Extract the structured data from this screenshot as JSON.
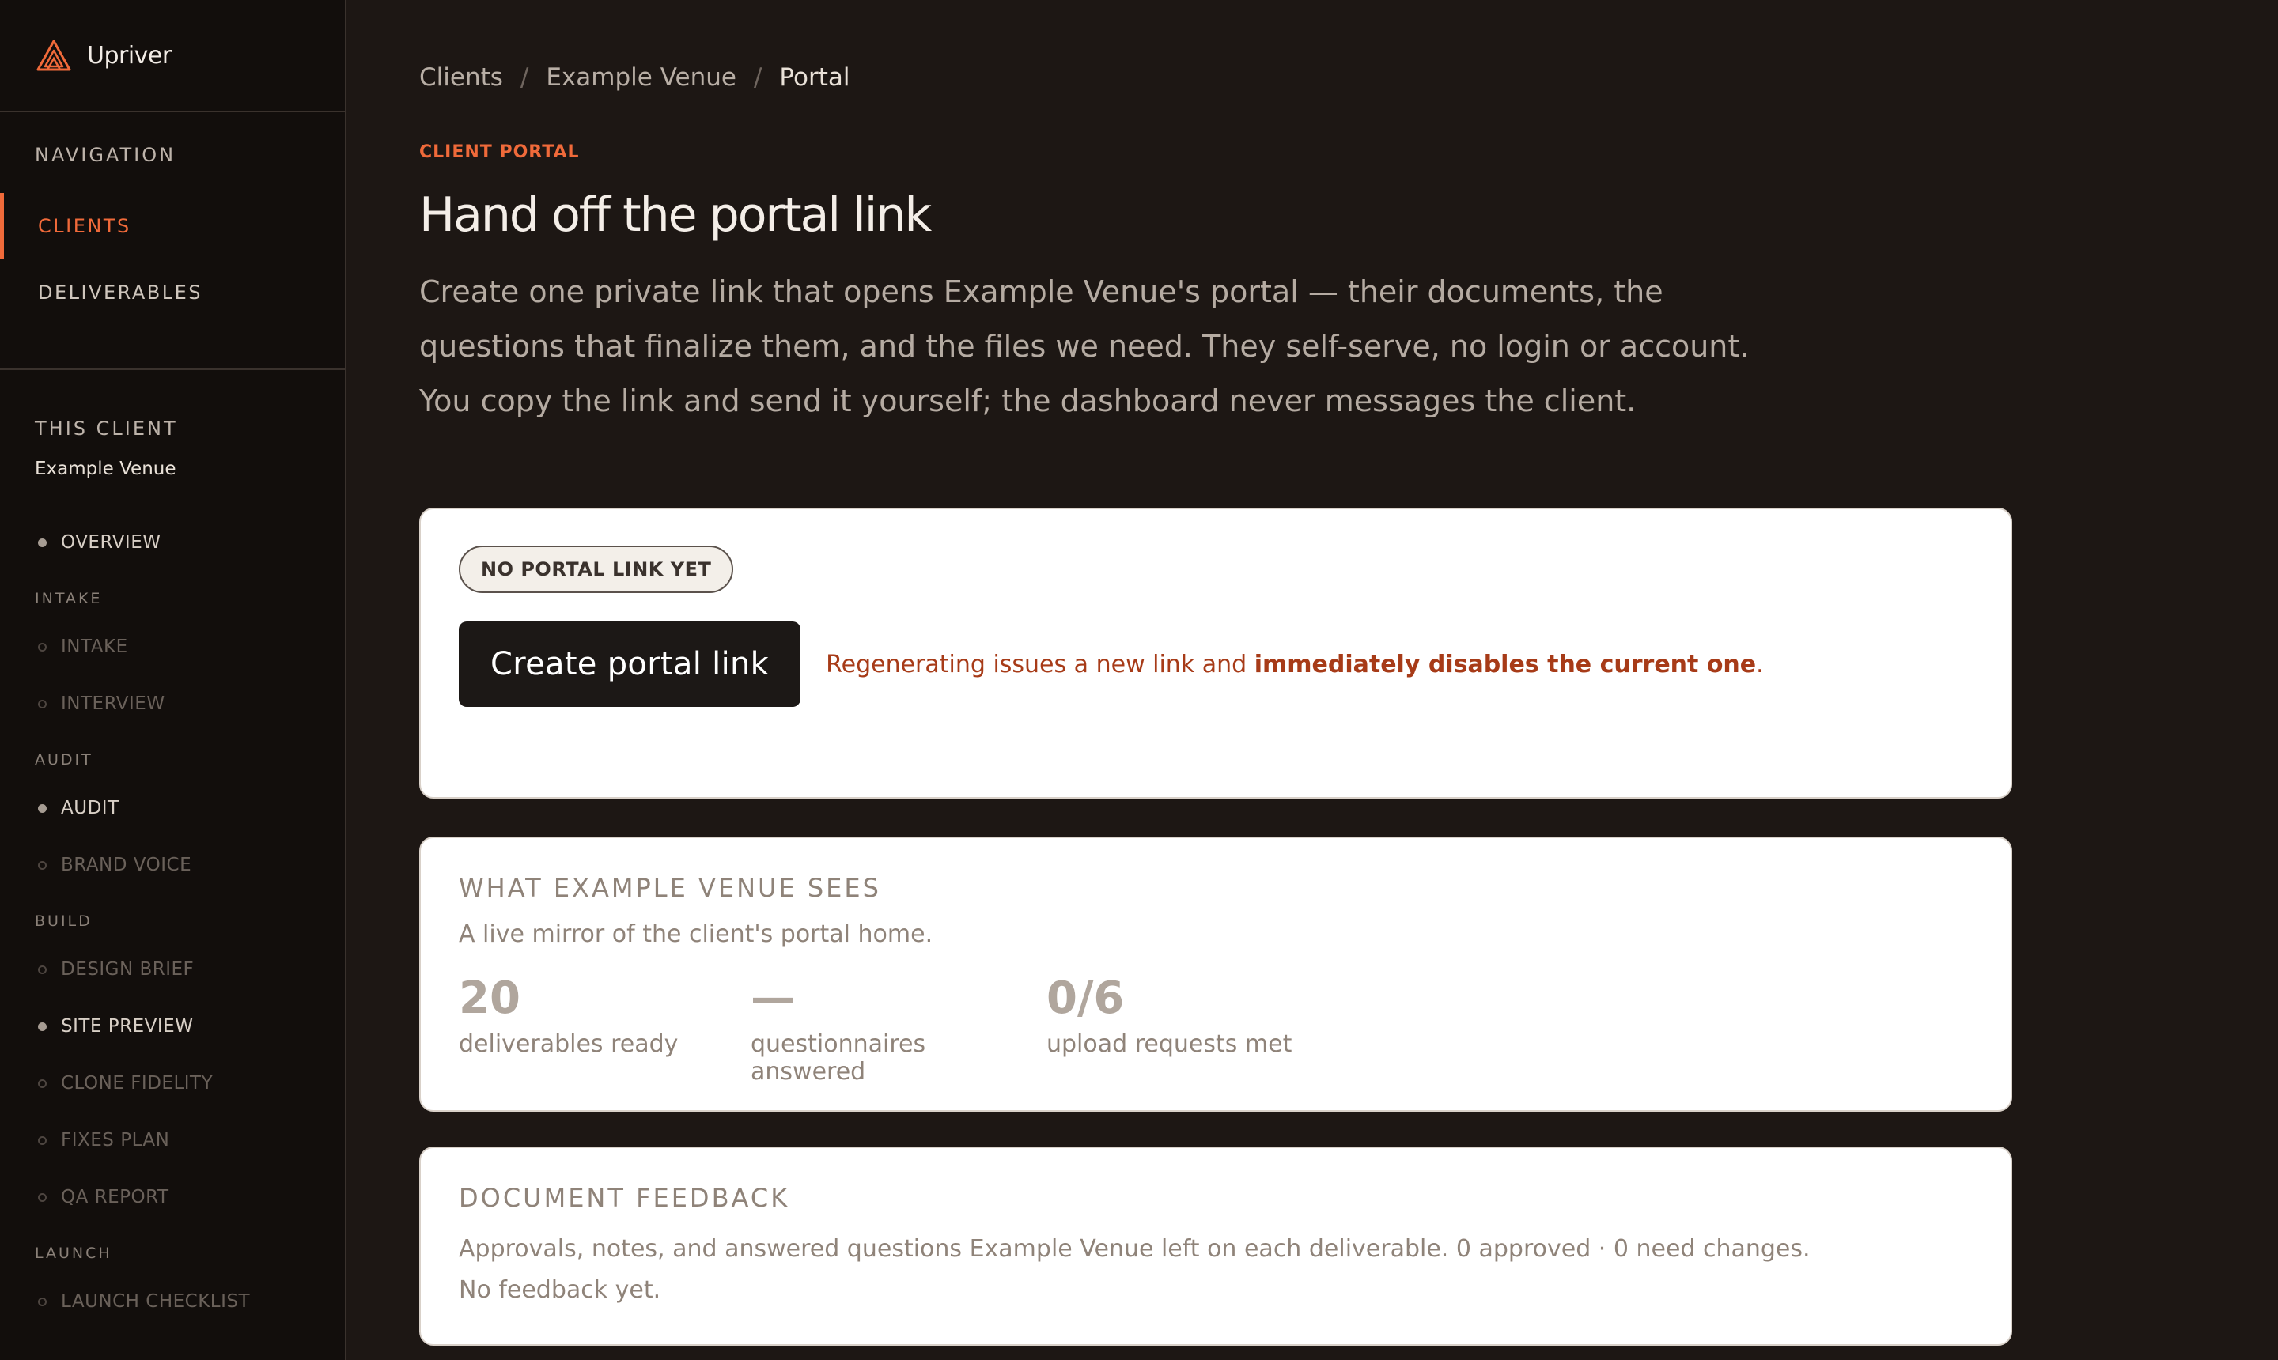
{
  "brand": {
    "name": "Upriver",
    "accent": "#f06a3a"
  },
  "sidebar": {
    "nav_title": "NAVIGATION",
    "nav_items": [
      {
        "label": "CLIENTS",
        "active": true
      },
      {
        "label": "DELIVERABLES",
        "active": false
      }
    ],
    "client_title": "THIS CLIENT",
    "client_name": "Example Venue",
    "overview": "OVERVIEW",
    "groups": [
      {
        "label": "INTAKE",
        "items": [
          {
            "label": "INTAKE",
            "done": false
          },
          {
            "label": "INTERVIEW",
            "done": false
          }
        ]
      },
      {
        "label": "AUDIT",
        "items": [
          {
            "label": "AUDIT",
            "done": true
          },
          {
            "label": "BRAND VOICE",
            "done": false
          }
        ]
      },
      {
        "label": "BUILD",
        "items": [
          {
            "label": "DESIGN BRIEF",
            "done": false
          },
          {
            "label": "SITE PREVIEW",
            "done": true
          },
          {
            "label": "CLONE FIDELITY",
            "done": false
          },
          {
            "label": "FIXES PLAN",
            "done": false
          },
          {
            "label": "QA REPORT",
            "done": false
          }
        ]
      },
      {
        "label": "LAUNCH",
        "items": [
          {
            "label": "LAUNCH CHECKLIST",
            "done": false
          }
        ]
      }
    ]
  },
  "breadcrumb": {
    "items": [
      "Clients",
      "Example Venue"
    ],
    "current": "Portal",
    "separator": "/"
  },
  "header": {
    "eyebrow": "CLIENT PORTAL",
    "title": "Hand off the portal link",
    "lead": "Create one private link that opens Example Venue's portal — their documents, the questions that finalize them, and the files we need. They self-serve, no login or account. You copy the link and send it yourself; the dashboard never messages the client."
  },
  "portal_card": {
    "status": "NO PORTAL LINK YET",
    "button": "Create portal link",
    "warning_prefix": "Regenerating issues a new link and ",
    "warning_bold": "immediately disables the current one",
    "warning_suffix": "."
  },
  "mirror_card": {
    "title": "WHAT EXAMPLE VENUE SEES",
    "desc": "A live mirror of the client's portal home.",
    "stats": [
      {
        "value": "20",
        "label": "deliverables ready"
      },
      {
        "value": "—",
        "label": "questionnaires answered"
      },
      {
        "value": "0/6",
        "label": "upload requests met"
      }
    ]
  },
  "feedback_card": {
    "title": "DOCUMENT FEEDBACK",
    "desc": "Approvals, notes, and answered questions Example Venue left on each deliverable. 0 approved · 0 need changes.",
    "empty": "No feedback yet."
  }
}
